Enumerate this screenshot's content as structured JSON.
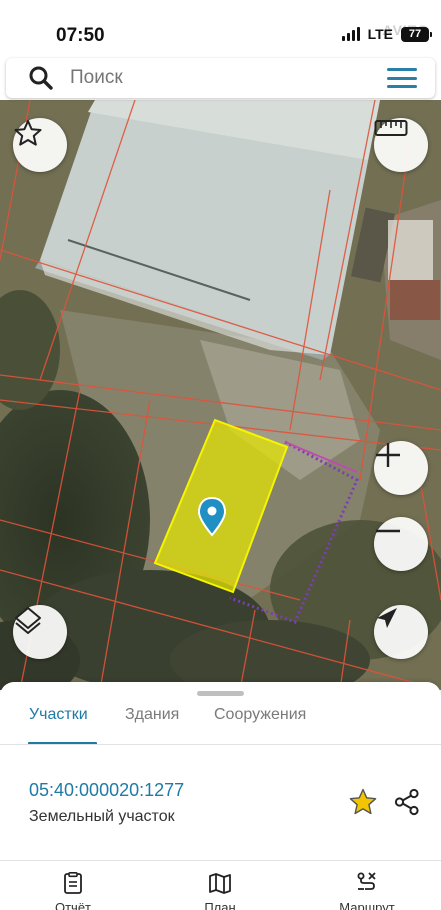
{
  "status_bar": {
    "time": "07:50",
    "network": "LTE",
    "battery": "77",
    "watermark": "AVITO"
  },
  "search": {
    "placeholder": "Поиск",
    "icon": "search-icon",
    "menu_icon": "hamburger-menu-icon"
  },
  "map": {
    "selected_parcel_color": "#e6e600",
    "boundary_color": "#e0533a",
    "marker_color": "#1f8fc4",
    "controls": [
      "star-icon",
      "ruler-icon",
      "zoom-in-icon",
      "zoom-out-icon",
      "layers-icon",
      "locate-icon"
    ]
  },
  "sheet": {
    "tabs": [
      {
        "label": "Участки",
        "active": true
      },
      {
        "label": "Здания",
        "active": false
      },
      {
        "label": "Сооружения",
        "active": false
      }
    ],
    "parcel": {
      "number": "05:40:000020:1277",
      "type": "Земельный участок"
    },
    "accent_color": "#1f7aa6",
    "star_color": "#f2c500"
  },
  "bottom_nav": [
    {
      "label": "Отчёт",
      "icon": "report-icon"
    },
    {
      "label": "План",
      "icon": "map-plan-icon"
    },
    {
      "label": "Маршрут",
      "icon": "route-icon"
    }
  ]
}
